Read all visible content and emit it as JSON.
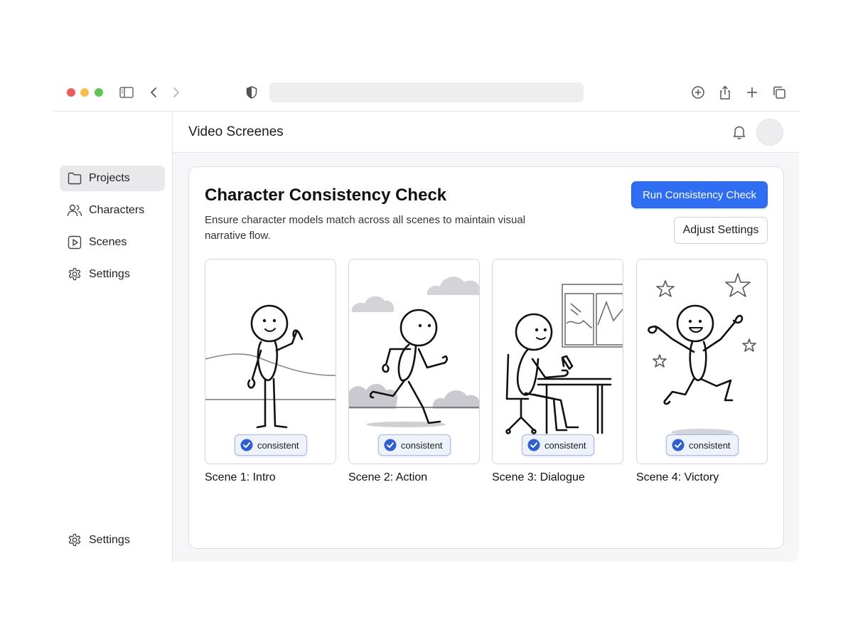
{
  "browser": {
    "icons": [
      "sidebar-toggle-icon",
      "back-icon",
      "forward-icon",
      "shield-icon",
      "download-icon",
      "share-icon",
      "new-tab-icon",
      "tabs-overview-icon"
    ]
  },
  "sidebar": {
    "items": [
      {
        "label": "Projects",
        "icon": "folder-icon",
        "active": true
      },
      {
        "label": "Characters",
        "icon": "users-icon",
        "active": false
      },
      {
        "label": "Scenes",
        "icon": "play-icon",
        "active": false
      },
      {
        "label": "Settings",
        "icon": "gear-icon",
        "active": false
      }
    ],
    "footer": {
      "label": "Settings",
      "icon": "gear-icon"
    }
  },
  "header": {
    "title": "Video Screenes"
  },
  "card": {
    "title": "Character Consistency Check",
    "description": "Ensure character models match across all scenes to maintain visual narrative flow.",
    "primary_button": "Run Consistency Check",
    "secondary_button": "Adjust Settings"
  },
  "scenes": [
    {
      "label": "Scene 1: Intro",
      "status": "consistent"
    },
    {
      "label": "Scene 2: Action",
      "status": "consistent"
    },
    {
      "label": "Scene 3: Dialogue",
      "status": "consistent"
    },
    {
      "label": "Scene 4: Victory",
      "status": "consistent"
    }
  ],
  "colors": {
    "accent": "#2f6ef2",
    "badge_bg": "#eef2fb",
    "badge_border": "#a9b9dc",
    "check": "#2f5fd0"
  }
}
